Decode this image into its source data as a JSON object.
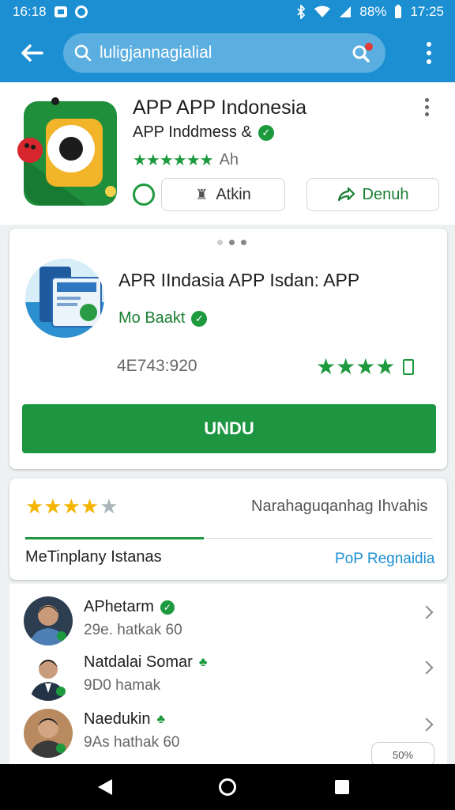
{
  "status_bar": {
    "left_time": "16:18",
    "battery": "88%",
    "clock": "17:25"
  },
  "toolbar": {
    "search_query": "luligjannagialial"
  },
  "app": {
    "title": "APP APP Indonesia",
    "developer": "APP Inddmess &",
    "stars": "★★★★★★",
    "rating_count": "Ah",
    "like_label": "Atkin",
    "share_label": "Denuh"
  },
  "promo": {
    "title": "APR IIndasia APP Isdan: APP",
    "developer": "Mo Baakt",
    "downloads": "4E743:920",
    "stars": "★★★★",
    "install_label": "UNDU"
  },
  "ratings": {
    "stars_on": "★★★★",
    "stars_off": "★",
    "summary": "Narahaguqanhag Ihvahis",
    "tab_active": "MeTinplany Istanas",
    "tab_other": "PoP Regnaidia"
  },
  "reviews": [
    {
      "name": "APhetarm",
      "meta": "29e. hatkak 60"
    },
    {
      "name": "Natdalai Somar",
      "meta": "9D0 hamak"
    },
    {
      "name": "Naedukin",
      "meta": "9As hathak 60"
    }
  ],
  "badge": "50%",
  "colors": {
    "accent_blue": "#1b8fd2",
    "accent_green": "#1e9641",
    "star_gold": "#f4b400"
  }
}
